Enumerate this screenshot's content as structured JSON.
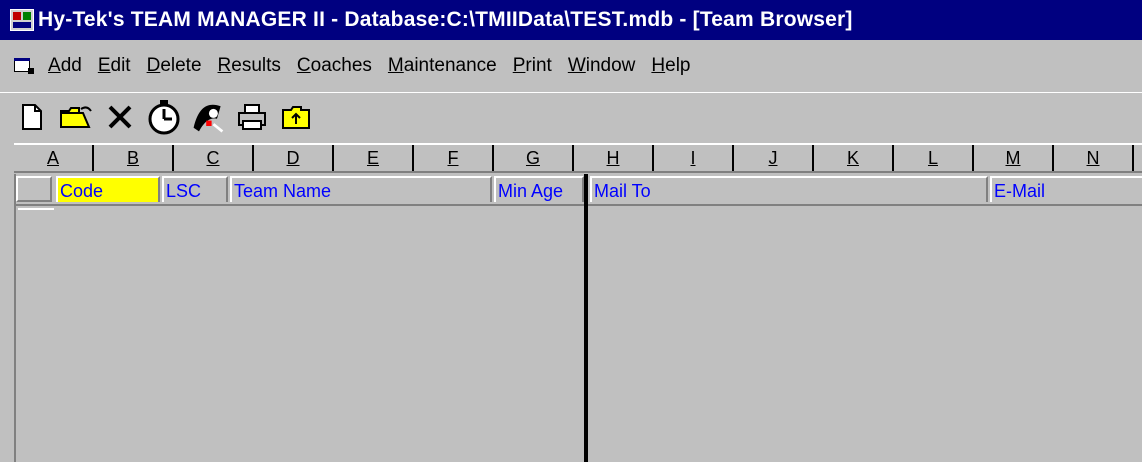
{
  "window": {
    "title": "Hy-Tek's TEAM MANAGER II - Database:C:\\TMIIData\\TEST.mdb - [Team Browser]"
  },
  "menu": {
    "items": [
      {
        "label": "Add",
        "accel": "A"
      },
      {
        "label": "Edit",
        "accel": "E"
      },
      {
        "label": "Delete",
        "accel": "D"
      },
      {
        "label": "Results",
        "accel": "R"
      },
      {
        "label": "Coaches",
        "accel": "C"
      },
      {
        "label": "Maintenance",
        "accel": "M"
      },
      {
        "label": "Print",
        "accel": "P"
      },
      {
        "label": "Window",
        "accel": "W"
      },
      {
        "label": "Help",
        "accel": "H"
      }
    ]
  },
  "toolbar": {
    "buttons": [
      "new-icon",
      "open-folder-icon",
      "delete-x-icon",
      "stopwatch-icon",
      "swimmer-icon",
      "printer-icon",
      "folder-up-icon"
    ]
  },
  "columns": {
    "letters": [
      "A",
      "B",
      "C",
      "D",
      "E",
      "F",
      "G",
      "H",
      "I",
      "J",
      "K",
      "L",
      "M",
      "N"
    ]
  },
  "grid": {
    "fields": {
      "code": "Code",
      "lsc": "LSC",
      "team_name": "Team Name",
      "min_age": "Min Age",
      "mail_to": "Mail To",
      "email": "E-Mail"
    },
    "highlight_color": "#ffff00",
    "field_text_color": "#0000ff"
  },
  "colors": {
    "titlebar": "#000080",
    "background": "#c0c0c0"
  }
}
